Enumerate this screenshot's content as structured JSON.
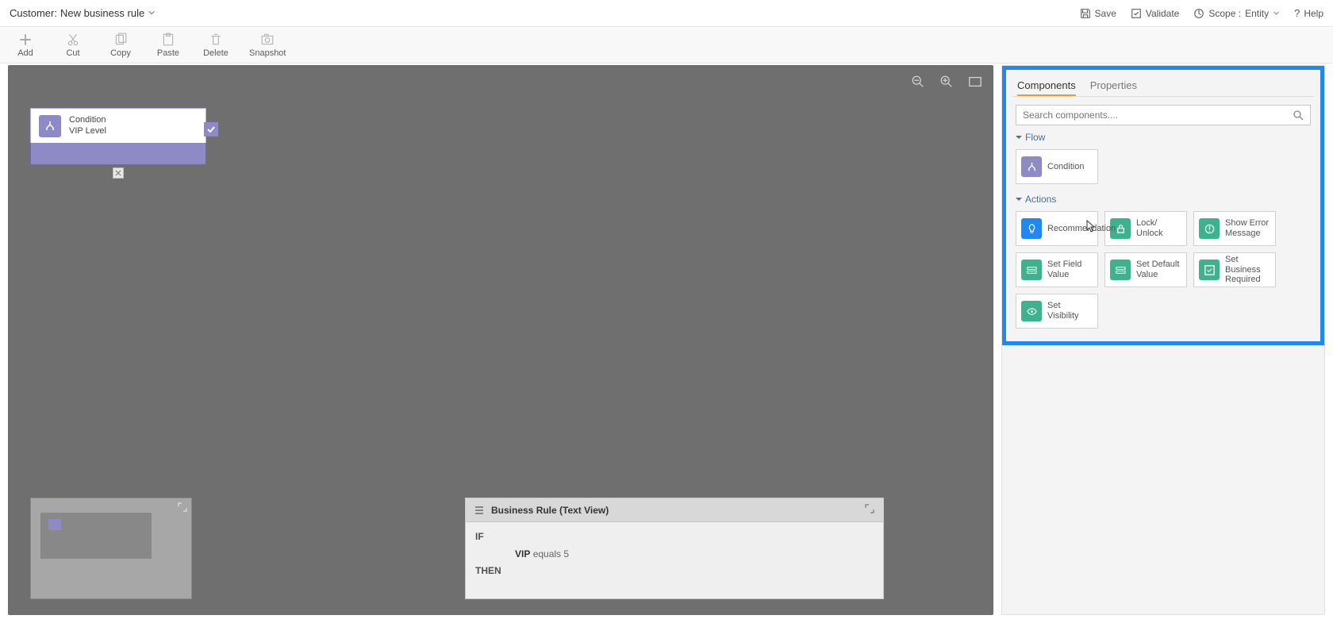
{
  "header": {
    "title_prefix": "Customer:",
    "title_name": "New business rule"
  },
  "top_actions": {
    "save": "Save",
    "validate": "Validate",
    "scope_label": "Scope :",
    "scope_value": "Entity",
    "help": "Help"
  },
  "toolbar": {
    "add": "Add",
    "cut": "Cut",
    "copy": "Copy",
    "paste": "Paste",
    "delete": "Delete",
    "snapshot": "Snapshot"
  },
  "condition": {
    "label": "Condition",
    "field": "VIP Level"
  },
  "text_view": {
    "title": "Business Rule (Text View)",
    "if": "IF",
    "then": "THEN",
    "rule_field": "VIP",
    "rule_expr": "equals 5"
  },
  "sidebar": {
    "tabs": {
      "components": "Components",
      "properties": "Properties"
    },
    "search_placeholder": "Search components....",
    "sections": {
      "flow": "Flow",
      "actions": "Actions"
    },
    "flow_items": {
      "condition": "Condition"
    },
    "action_items": {
      "recommendation": "Recommendation",
      "lock_unlock": "Lock/ Unlock",
      "show_error": "Show Error Message",
      "set_field": "Set Field Value",
      "set_default": "Set Default Value",
      "set_required": "Set Business Required",
      "set_visibility": "Set Visibility"
    }
  }
}
